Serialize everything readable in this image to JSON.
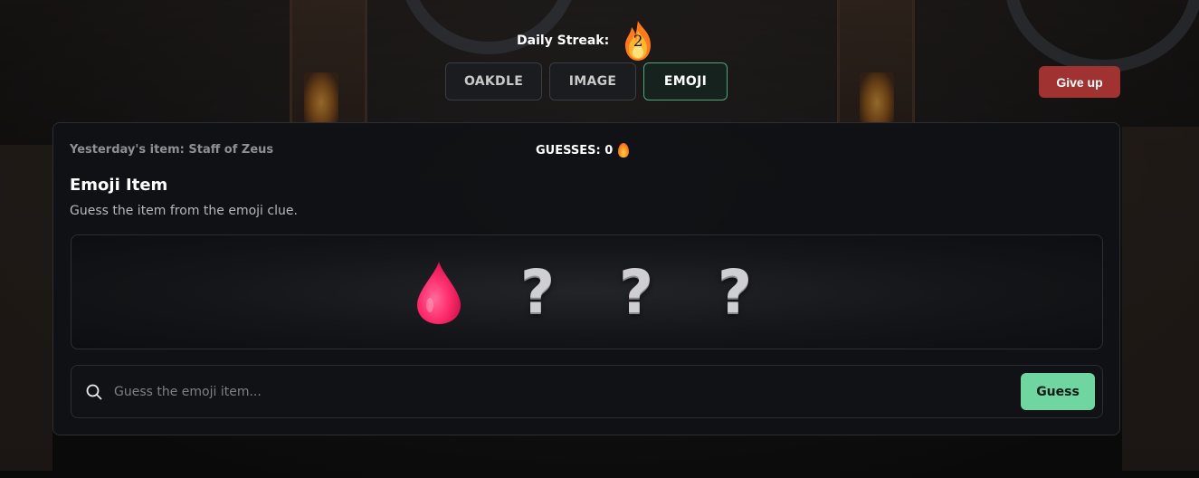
{
  "header": {
    "streak_label": "Daily Streak:",
    "streak_count": "2",
    "streak_icon": "fire-icon"
  },
  "tabs": [
    {
      "label": "OAKDLE",
      "active": false
    },
    {
      "label": "IMAGE",
      "active": false
    },
    {
      "label": "EMOJI",
      "active": true
    }
  ],
  "give_up_label": "Give up",
  "panel": {
    "yesterday": "Yesterday's item: Staff of Zeus",
    "guesses_label": "GUESSES: 0",
    "title": "Emoji Item",
    "subtitle": "Guess the item from the emoji clue.",
    "emojis": [
      {
        "icon": "blood-drop-icon",
        "revealed": true
      },
      {
        "icon": "question-mark-icon",
        "revealed": false,
        "char": "?"
      },
      {
        "icon": "question-mark-icon",
        "revealed": false,
        "char": "?"
      },
      {
        "icon": "question-mark-icon",
        "revealed": false,
        "char": "?"
      }
    ],
    "search": {
      "placeholder": "Guess the emoji item...",
      "value": "",
      "button_label": "Guess"
    }
  },
  "colors": {
    "accent_green": "#6fd5a1",
    "danger_red": "#a13232",
    "drop_pink": "#ff3d7a"
  }
}
